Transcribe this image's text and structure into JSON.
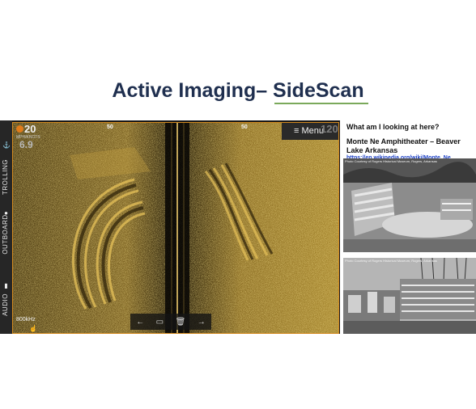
{
  "slide": {
    "title": "Active Imaging– SideScan"
  },
  "sonar": {
    "depth": "20",
    "speed_unit": "MPH/KNOTS",
    "speed": "6.9",
    "range_left": "50",
    "range_right": "50",
    "menu_label": "Menu",
    "zoom": "120",
    "frequency": "800kHz"
  },
  "rail": {
    "items": [
      {
        "label": "TROLLING"
      },
      {
        "label": "OUTBOARD"
      },
      {
        "label": "AUDIO"
      }
    ]
  },
  "side": {
    "question": "What am I looking at here?",
    "place": "Monte Ne Amphitheater – Beaver Lake Arkansas",
    "link": "https://en.wikipedia.org/wiki/Monte_Ne",
    "photo1_credit": "Photo Courtesy of Rogers Historical Museum, Rogers, Arkansas",
    "photo2_credit": "Photo Courtesy of Rogers Historical Museum, Rogers, Arkansas"
  },
  "colors": {
    "accent_orange": "#e07b1a",
    "sonar_gold": "#b8902d",
    "title_navy": "#1f2f4f",
    "link_blue": "#1a3fc5"
  }
}
